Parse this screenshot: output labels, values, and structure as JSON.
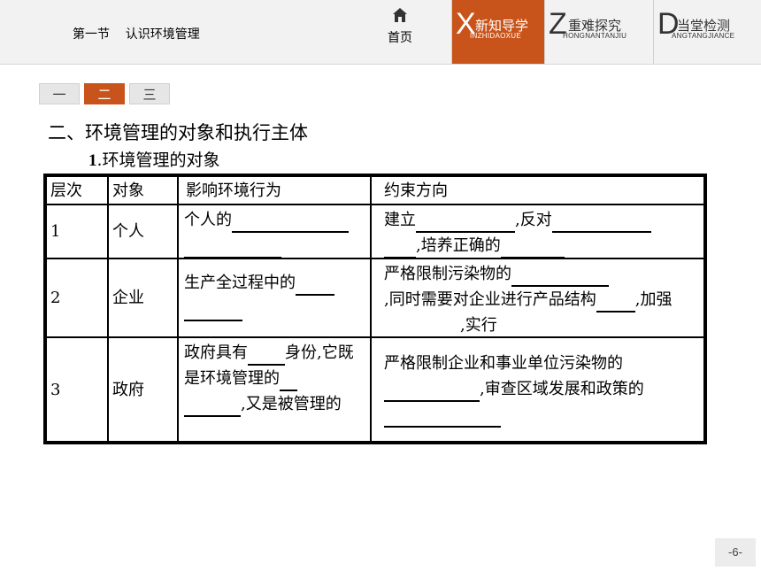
{
  "header": {
    "section_title": "第一节    认识环境管理",
    "home_label": "首页",
    "home_icon": "home-icon",
    "tabs": [
      {
        "letter": "X",
        "cn": "新知导学",
        "pinyin": "INZHIDAOXUE",
        "active": true
      },
      {
        "letter": "Z",
        "cn": "重难探究",
        "pinyin": "HONGNANTANJIU",
        "active": false
      },
      {
        "letter": "D",
        "cn": "当堂检测",
        "pinyin": "ANGTANGJIANCE",
        "active": false
      }
    ],
    "accent_color": "#c9541b"
  },
  "subtabs": [
    "一",
    "二",
    "三"
  ],
  "heading": "二、环境管理的对象和执行主体",
  "subheading": {
    "num": "1",
    "text": ".环境管理的对象"
  },
  "table": {
    "columns": [
      "层次",
      "对象",
      "影响环境行为",
      "约束方向"
    ],
    "rows": [
      {
        "level": "1",
        "object": "个人",
        "behavior": [
          "个人的"
        ],
        "constraint": [
          "建立",
          ",反对",
          ",培养正确的"
        ]
      },
      {
        "level": "2",
        "object": "企业",
        "behavior": [
          "生产全过程中的"
        ],
        "constraint": [
          "严格限制污染物的",
          ",同时需要对企业进行产品结构",
          ",加强",
          ",实行"
        ]
      },
      {
        "level": "3",
        "object": "政府",
        "behavior": [
          "政府具有",
          "身份,它既是环境管理的",
          ",又是被管理的"
        ],
        "constraint": [
          "严格限制企业和事业单位污染物的",
          ",审查区域发展和政策的"
        ]
      }
    ]
  },
  "page_number": "-6-"
}
